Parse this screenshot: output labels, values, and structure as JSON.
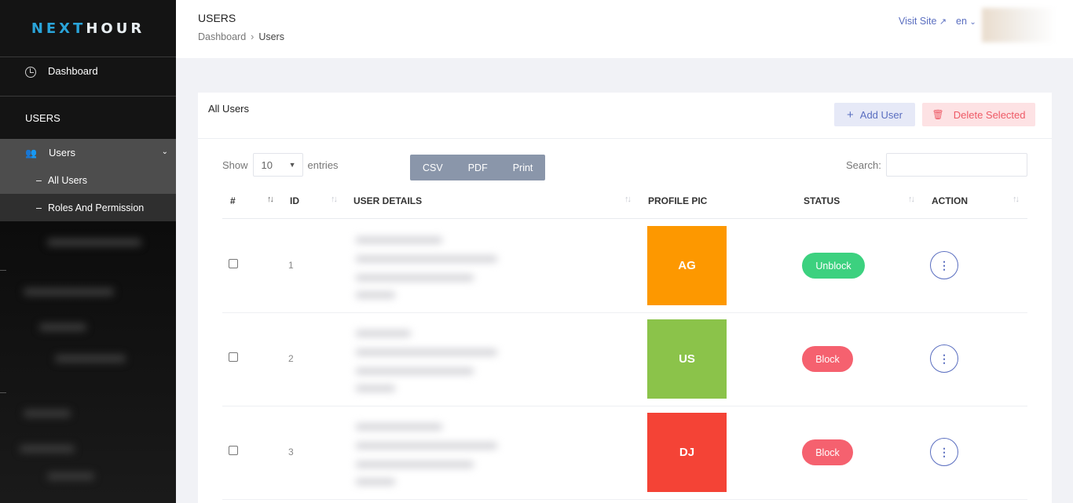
{
  "sidebar": {
    "logo_part1": "NEXT",
    "logo_part2": "HOUR",
    "dashboard_label": "Dashboard",
    "section_label": "USERS",
    "group_label": "Users",
    "items": [
      {
        "label": "All Users"
      },
      {
        "label": "Roles And Permission"
      }
    ]
  },
  "header": {
    "title": "USERS",
    "breadcrumb": [
      "Dashboard",
      "Users"
    ],
    "visit_site": "Visit Site",
    "lang": "en"
  },
  "card": {
    "title": "All Users",
    "add_user": "Add User",
    "delete_selected": "Delete Selected",
    "show_label": "Show",
    "entries_value": "10",
    "entries_label": "entries",
    "exports": [
      "CSV",
      "PDF",
      "Print"
    ],
    "search_label": "Search:"
  },
  "table": {
    "columns": [
      "#",
      "ID",
      "USER DETAILS",
      "PROFILE PIC",
      "STATUS",
      "ACTION"
    ],
    "rows": [
      {
        "id": "1",
        "initials": "AG",
        "pic_color": "#fd9800",
        "status": "Unblock",
        "status_color": "#3cd17f"
      },
      {
        "id": "2",
        "initials": "US",
        "pic_color": "#8bc34a",
        "status": "Block",
        "status_color": "#f5616f"
      },
      {
        "id": "3",
        "initials": "DJ",
        "pic_color": "#f44336",
        "status": "Block",
        "status_color": "#f5616f"
      }
    ]
  }
}
